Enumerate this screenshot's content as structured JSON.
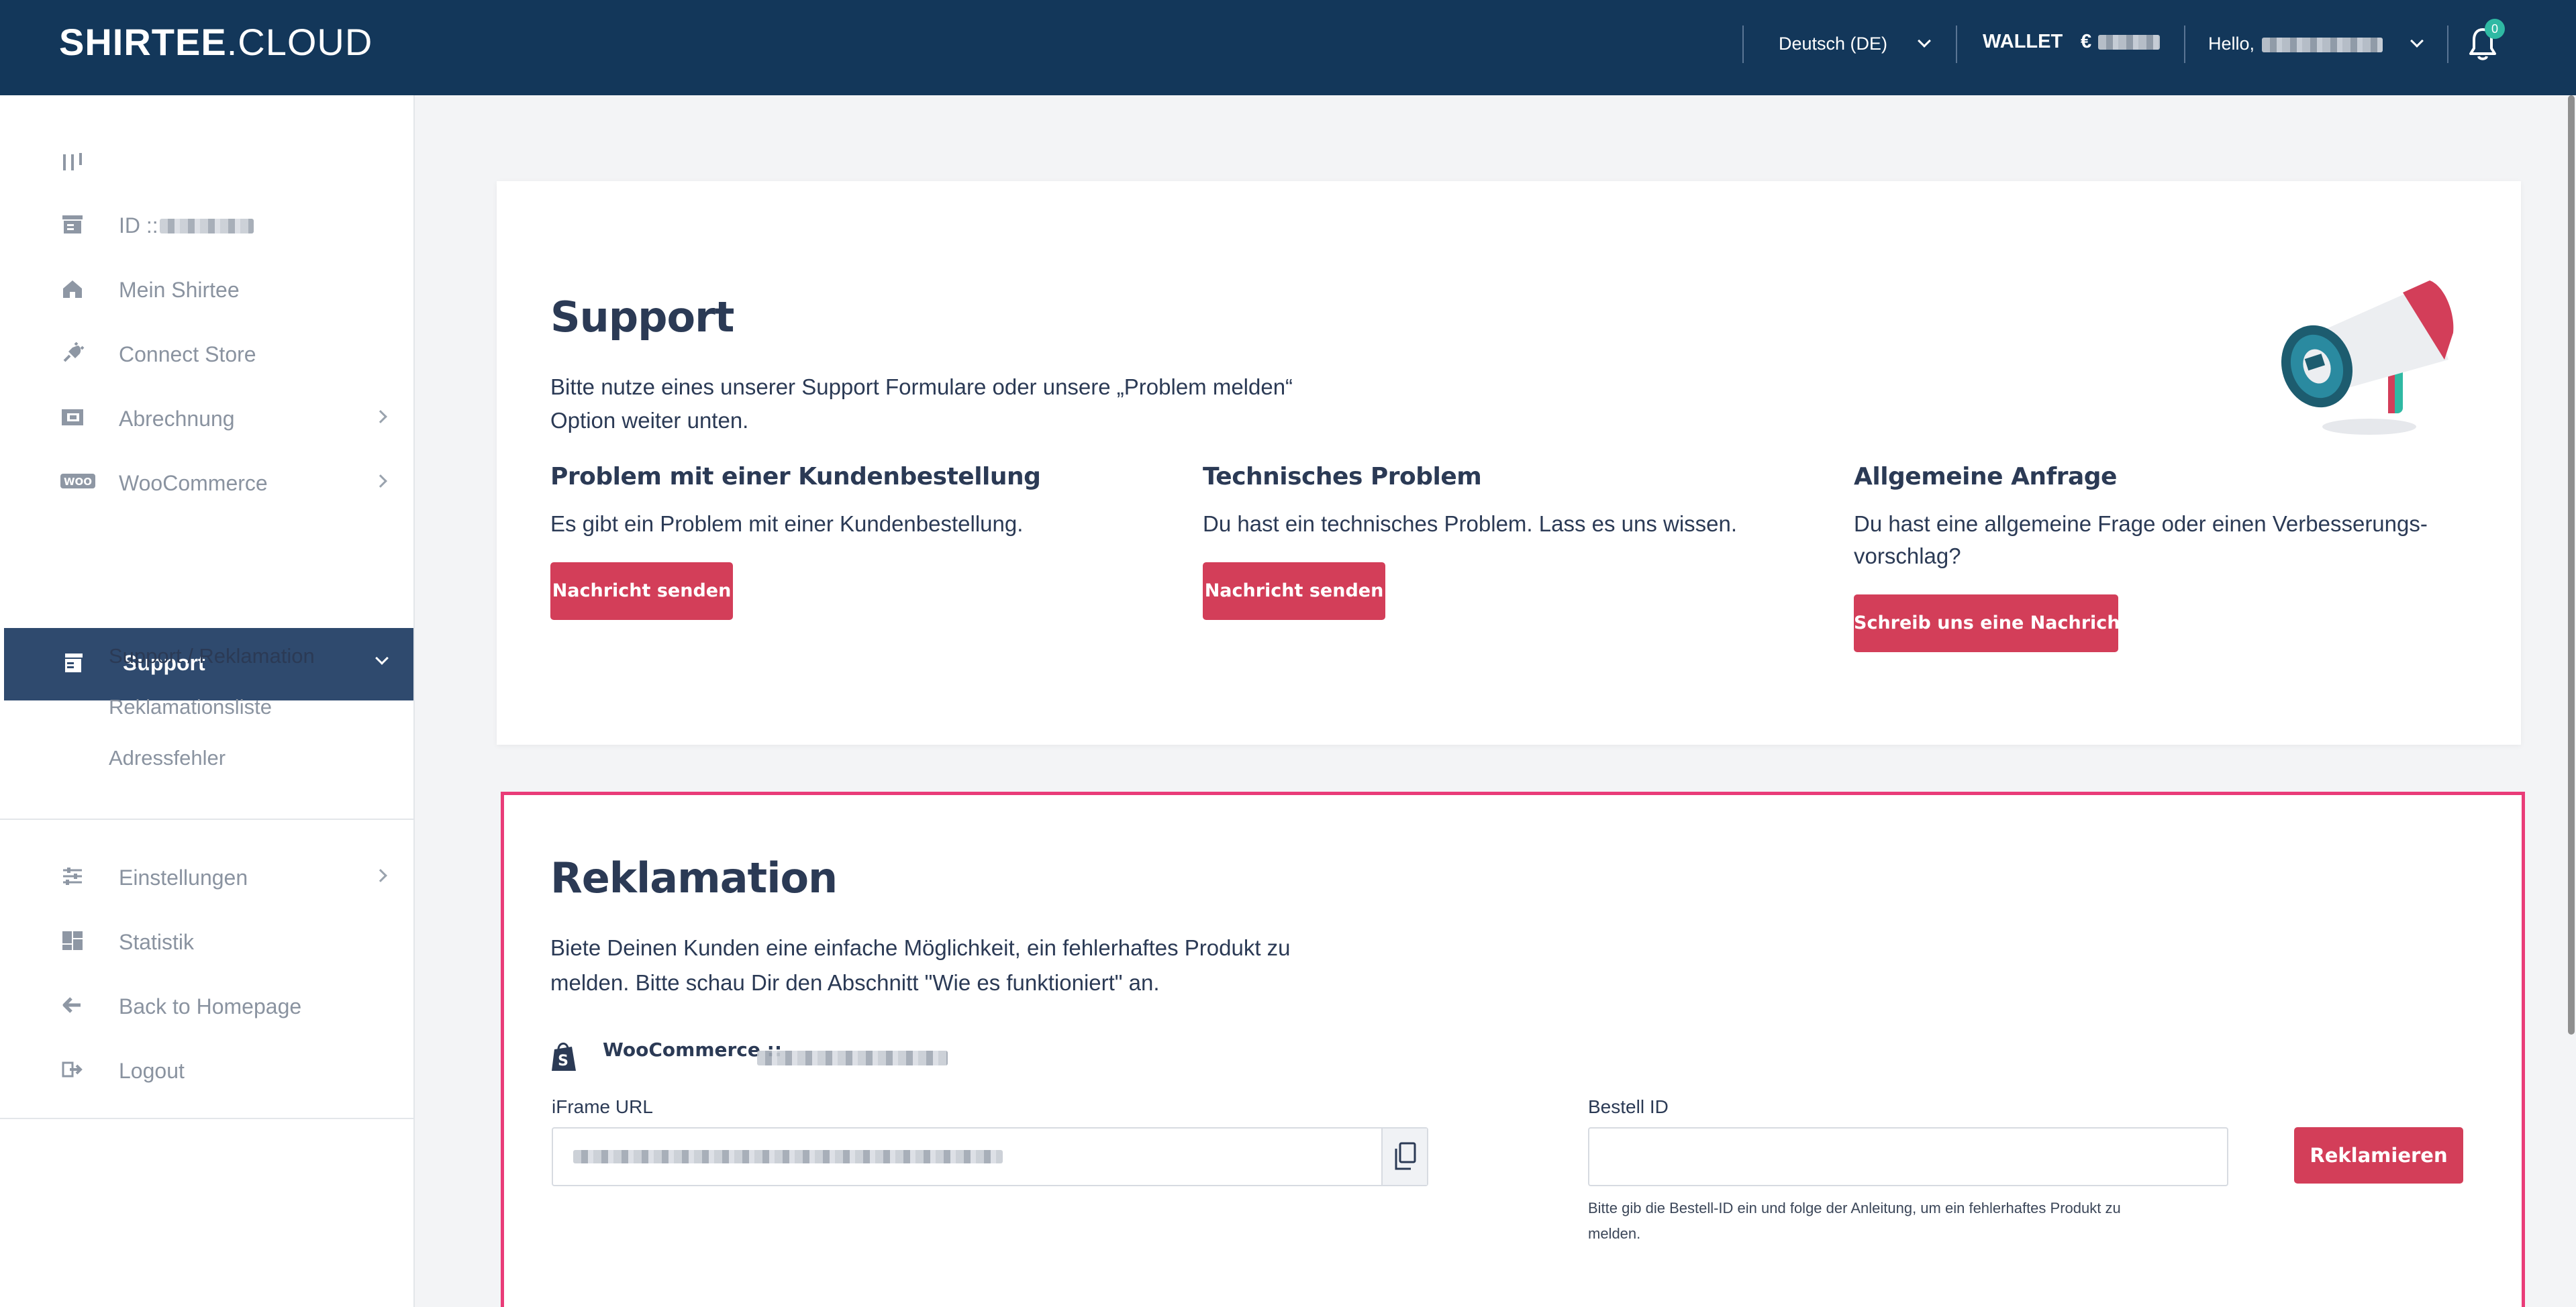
{
  "header": {
    "logo_bold": "SHIRTEE",
    "logo_thin": ".CLOUD",
    "language": "Deutsch (DE)",
    "wallet_label": "WALLET",
    "wallet_currency": "€",
    "hello": "Hello, ",
    "notification_count": "0"
  },
  "sidebar": {
    "id_label": "ID ::",
    "items": [
      {
        "label": "Mein Shirtee",
        "icon": "home-icon"
      },
      {
        "label": "Connect Store",
        "icon": "plug-icon"
      },
      {
        "label": "Abrechnung",
        "icon": "wallet-icon"
      },
      {
        "label": "WooCommerce",
        "icon": "woocommerce-icon"
      },
      {
        "label": "Support",
        "icon": "store-icon"
      },
      {
        "label": "Einstellungen",
        "icon": "sliders-icon"
      },
      {
        "label": "Statistik",
        "icon": "dashboard-icon"
      },
      {
        "label": "Back to Homepage",
        "icon": "arrow-left-icon"
      },
      {
        "label": "Logout",
        "icon": "logout-icon"
      }
    ],
    "sub_items": [
      "Support / Reklamation",
      "Reklamationsliste",
      "Adressfehler"
    ]
  },
  "support": {
    "title": "Support",
    "intro_line1": "Bitte nutze eines unserer Support Formulare oder unsere „Problem melden“",
    "intro_line2": "Option weiter unten.",
    "columns": [
      {
        "title": "Problem mit einer Kundenbestellung",
        "text": "Es gibt ein Problem mit einer Kundenbestellung.",
        "button": "Nachricht senden"
      },
      {
        "title": "Technisches Problem",
        "text": "Du hast ein technisches Problem. Lass es uns wissen.",
        "button": "Nachricht senden"
      },
      {
        "title": "Allgemeine Anfrage",
        "text_line1": "Du hast eine allgemeine Frage oder einen Verbesserungs-",
        "text_line2": "vorschlag?",
        "button": "Schreib uns eine Nachricht"
      }
    ]
  },
  "reklamation": {
    "title": "Reklamation",
    "intro_line1": "Biete Deinen Kunden eine einfache Möglichkeit, ein fehlerhaftes Produkt zu",
    "intro_line2": "melden. Bitte schau Dir den Abschnitt \"Wie es funktioniert\" an.",
    "store_label": "WooCommerce ::",
    "iframe_label": "iFrame URL",
    "bestell_label": "Bestell ID",
    "bestell_value": "",
    "button": "Reklamieren",
    "hint_line1": "Bitte gib die Bestell-ID ein und folge der Anleitung, um ein fehlerhaftes Produkt zu",
    "hint_line2": "melden."
  },
  "colors": {
    "header_bg": "#13375a",
    "accent_red": "#d33e59",
    "active_nav": "#2f4a6e",
    "highlight_border": "#e93c78"
  }
}
